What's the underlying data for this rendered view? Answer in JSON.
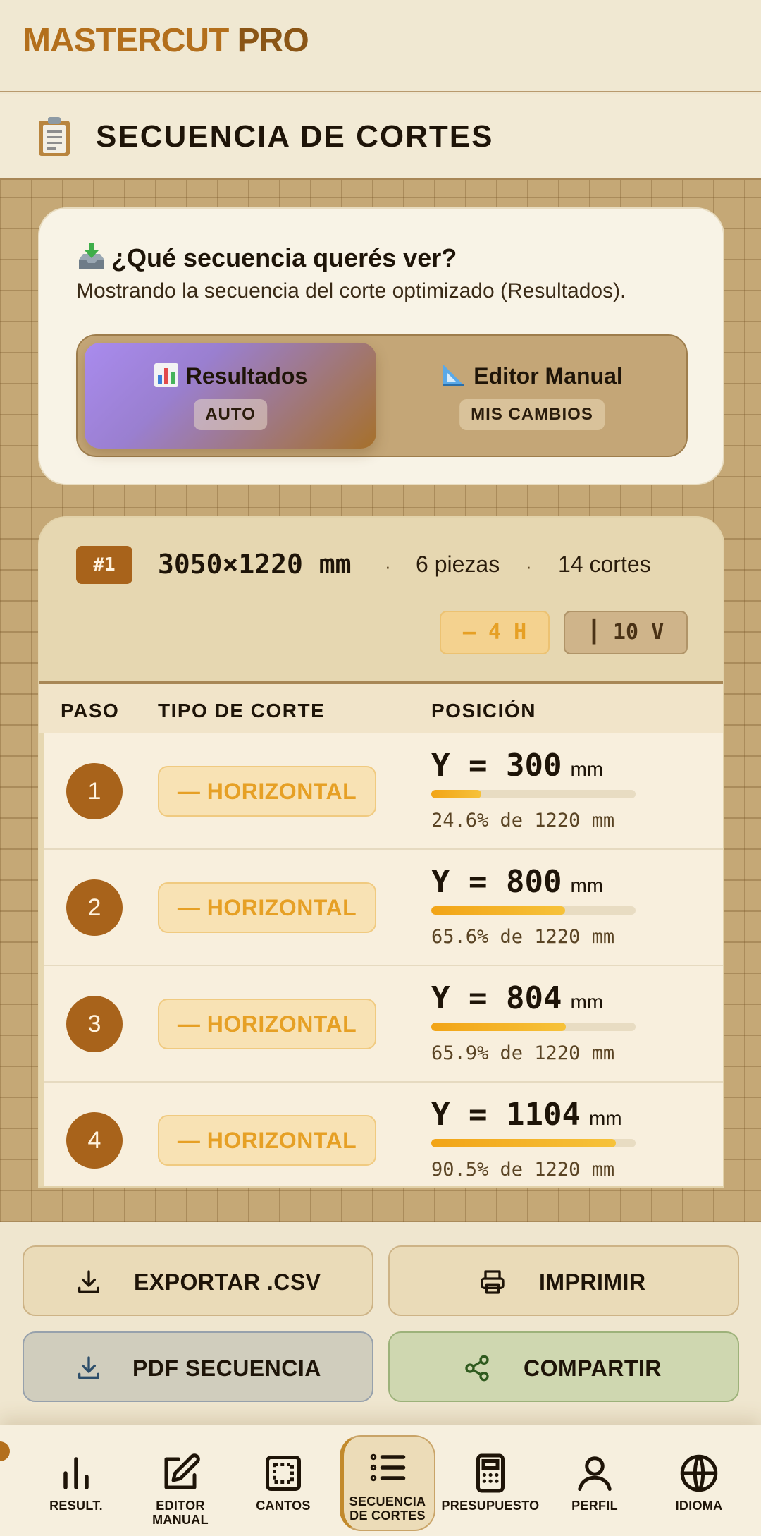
{
  "app": {
    "title_a": "MASTERCUT",
    "title_b": "PRO"
  },
  "header": {
    "icon": "clipboard-icon",
    "title": "SECUENCIA DE CORTES"
  },
  "selector": {
    "title": "¿Qué secuencia querés ver?",
    "description": "Mostrando la secuencia del corte optimizado (Resultados).",
    "options": [
      {
        "label": "Resultados",
        "badge": "AUTO",
        "icon": "bar-chart-icon",
        "active": true
      },
      {
        "label": "Editor Manual",
        "badge": "MIS CAMBIOS",
        "icon": "triangle-ruler-icon",
        "active": false
      }
    ]
  },
  "sheet": {
    "badge": "#1",
    "dims": "3050×1220 mm",
    "sep": "·",
    "pieces": "6 piezas",
    "cuts": "14 cortes",
    "h_chip": "— 4 H",
    "v_chip": "┃ 10 V",
    "colors": {
      "accent": "#a8631b",
      "horizontal": "#e6a025"
    }
  },
  "table": {
    "headers": {
      "step": "PASO",
      "type": "TIPO DE CORTE",
      "position": "POSICIÓN"
    },
    "rows": [
      {
        "step": "1",
        "type": "— HORIZONTAL",
        "axis": "Y",
        "eq": "=",
        "value": "300",
        "unit": "mm",
        "fraction": 0.246,
        "pct_text": "24.6% de 1220 mm"
      },
      {
        "step": "2",
        "type": "— HORIZONTAL",
        "axis": "Y",
        "eq": "=",
        "value": "800",
        "unit": "mm",
        "fraction": 0.656,
        "pct_text": "65.6% de 1220 mm"
      },
      {
        "step": "3",
        "type": "— HORIZONTAL",
        "axis": "Y",
        "eq": "=",
        "value": "804",
        "unit": "mm",
        "fraction": 0.659,
        "pct_text": "65.9% de 1220 mm"
      },
      {
        "step": "4",
        "type": "— HORIZONTAL",
        "axis": "Y",
        "eq": "=",
        "value": "1104",
        "unit": "mm",
        "fraction": 0.905,
        "pct_text": "90.5% de 1220 mm"
      }
    ]
  },
  "actions": {
    "export_csv": "EXPORTAR .CSV",
    "print": "IMPRIMIR",
    "pdf": "PDF SECUENCIA",
    "share": "COMPARTIR"
  },
  "nav": [
    {
      "key": "result",
      "label": "RESULT.",
      "icon": "bar-chart-icon"
    },
    {
      "key": "editor",
      "label": "EDITOR\nMANUAL",
      "icon": "edit-icon"
    },
    {
      "key": "cantos",
      "label": "CANTOS",
      "icon": "frame-icon"
    },
    {
      "key": "secuencia",
      "label": "SECUENCIA\nDE CORTES",
      "icon": "list-icon",
      "active": true
    },
    {
      "key": "presupuesto",
      "label": "PRESUPUESTO",
      "icon": "calculator-icon"
    },
    {
      "key": "perfil",
      "label": "PERFIL",
      "icon": "user-icon"
    },
    {
      "key": "idioma",
      "label": "IDIOMA",
      "icon": "globe-icon"
    }
  ]
}
